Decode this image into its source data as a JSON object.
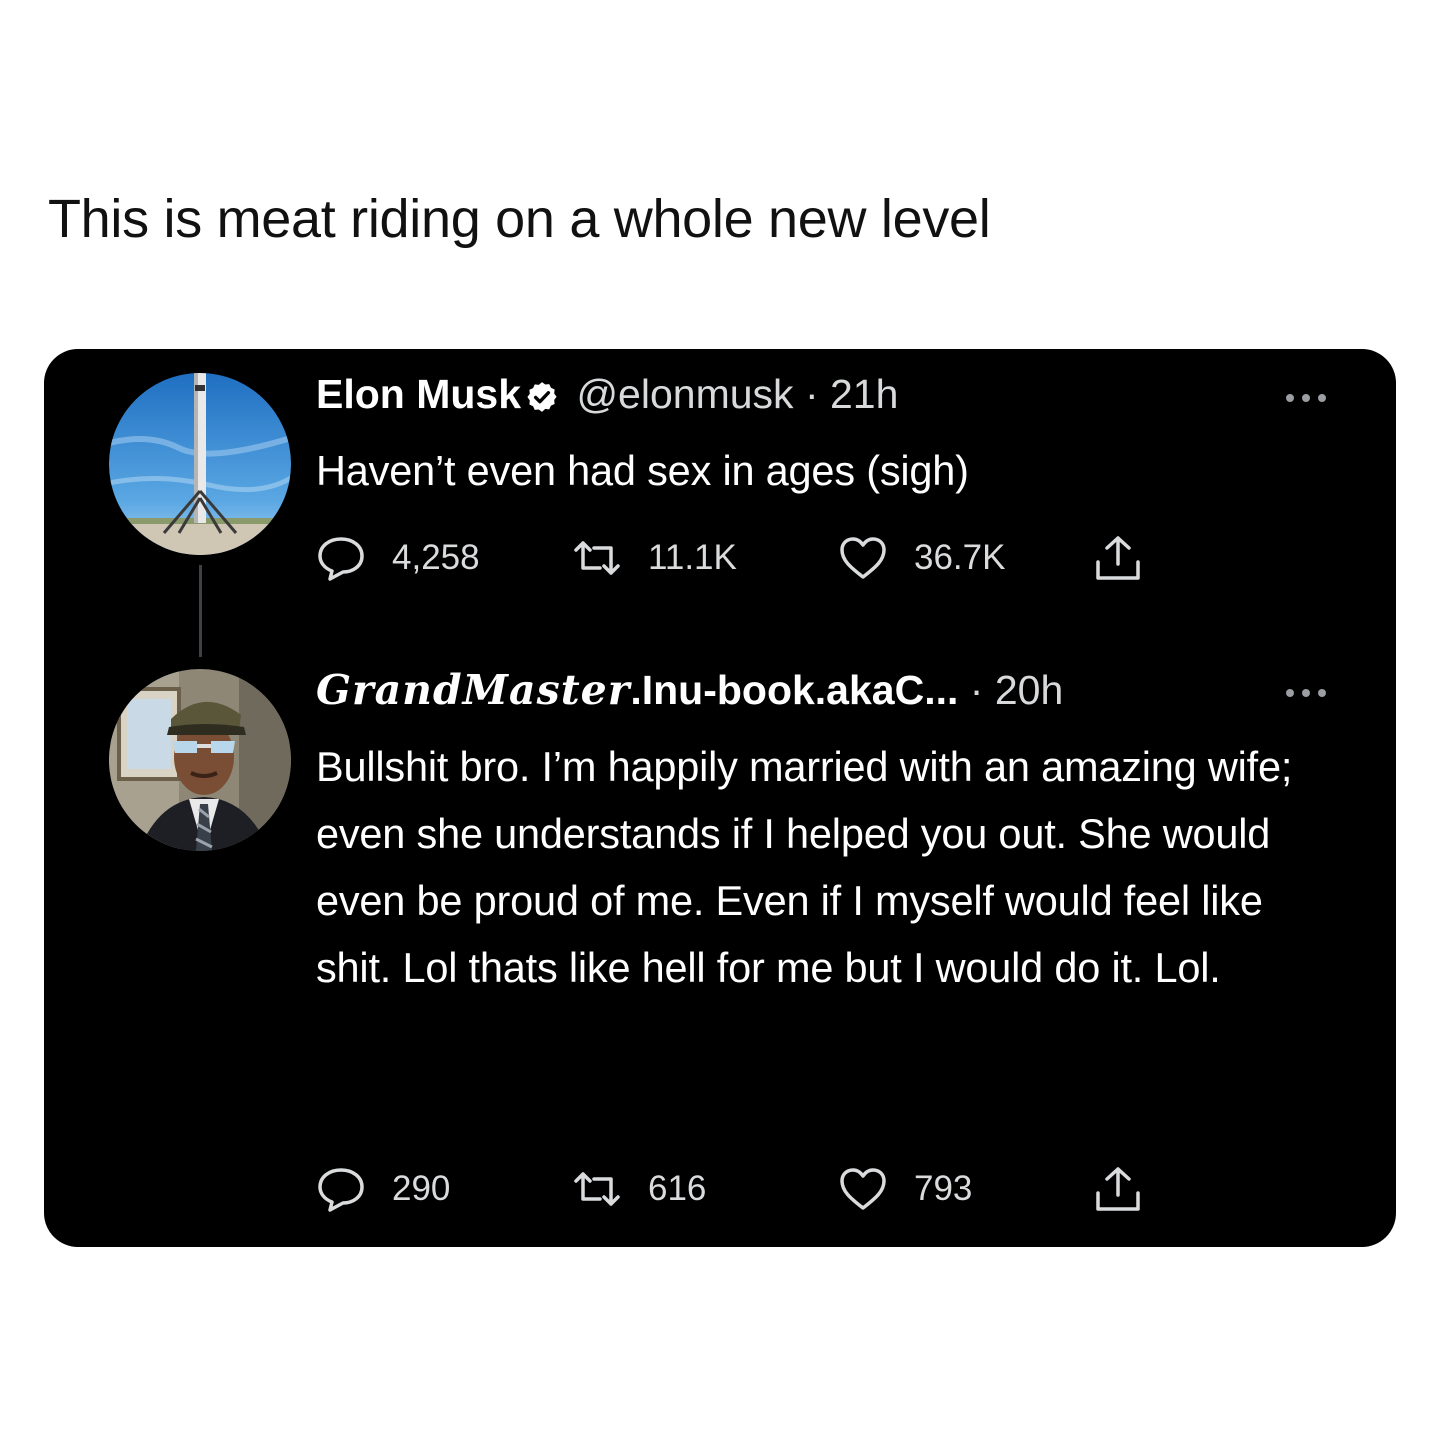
{
  "caption": "This is meat riding on a whole new level",
  "tweets": [
    {
      "display_name": "Elon Musk",
      "handle": "@elonmusk",
      "separator": "·",
      "time": "21h",
      "text": "Haven’t even had sex in ages (sigh)",
      "verified": true,
      "stats": {
        "replies": "4,258",
        "retweets": "11.1K",
        "likes": "36.7K"
      }
    },
    {
      "display_name_prefix": "GrandMaster",
      "display_name_rest": ".Inu-book.akaC...",
      "separator": "·",
      "time": "20h",
      "text": "Bullshit bro. I’m happily married with an amazing wife; even she understands if I helped you out. She would even be proud of me. Even if I myself would feel like shit. Lol thats like hell for me but I would do it. Lol.",
      "stats": {
        "replies": "290",
        "retweets": "616",
        "likes": "793"
      }
    }
  ],
  "icons": {
    "reply": "reply-icon",
    "retweet": "retweet-icon",
    "like": "like-icon",
    "share": "share-icon",
    "more": "more-icon",
    "verified": "verified-badge-icon"
  },
  "colors": {
    "card": "#000000",
    "text": "#ffffff",
    "muted": "#d7d9db"
  }
}
